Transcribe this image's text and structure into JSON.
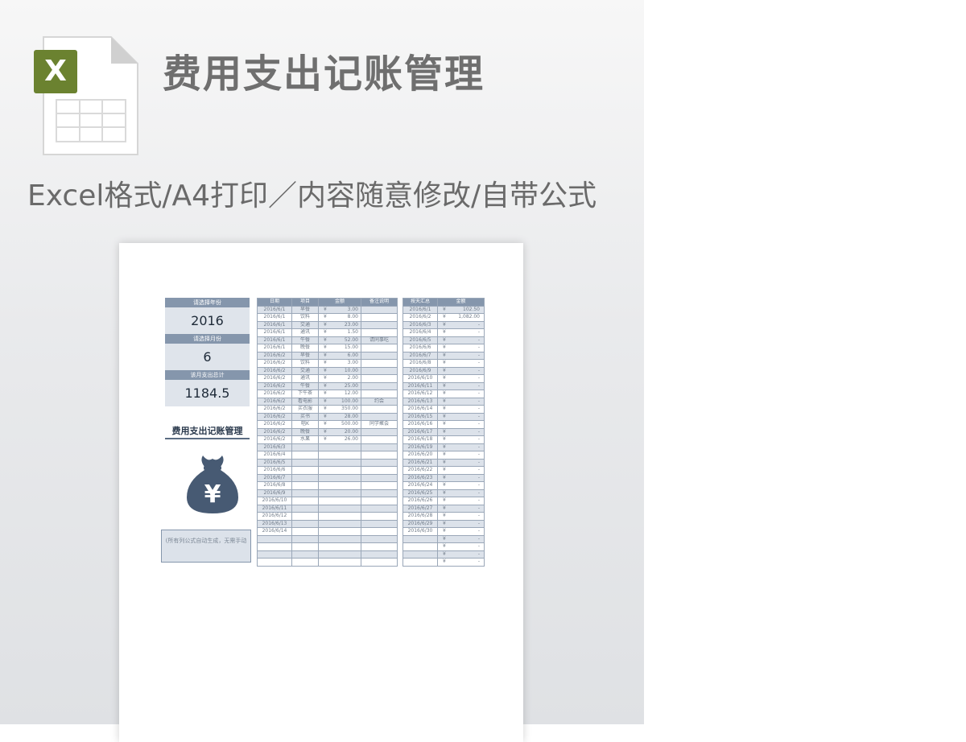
{
  "header": {
    "title": "费用支出记账管理",
    "subtitle": "Excel格式/A4打印／内容随意修改/自带公式",
    "icon": "excel-file-icon",
    "icon_letter": "X",
    "accent": "#6b8230"
  },
  "sheet": {
    "left_panel": {
      "year_label": "请选择年份",
      "year_value": "2016",
      "month_label": "请选择月份",
      "month_value": "6",
      "total_label": "该月支出总计",
      "total_value": "1184.5",
      "title": "费用支出记账管理",
      "bag_icon": "money-bag-icon",
      "bag_symbol": "¥",
      "note": "(所有列公式自动生成，无需手动"
    },
    "main_table": {
      "headers": [
        "日期",
        "项目",
        "金额",
        "备注说明"
      ],
      "rows": [
        {
          "date": "2016/6/1",
          "item": "早餐",
          "amount": "3.00",
          "note": ""
        },
        {
          "date": "2016/6/1",
          "item": "饮料",
          "amount": "8.00",
          "note": ""
        },
        {
          "date": "2016/6/1",
          "item": "交通",
          "amount": "23.00",
          "note": ""
        },
        {
          "date": "2016/6/1",
          "item": "通讯",
          "amount": "1.50",
          "note": ""
        },
        {
          "date": "2016/6/1",
          "item": "午餐",
          "amount": "52.00",
          "note": "请同事吃"
        },
        {
          "date": "2016/6/1",
          "item": "晚餐",
          "amount": "15.00",
          "note": ""
        },
        {
          "date": "2016/6/2",
          "item": "早餐",
          "amount": "6.00",
          "note": ""
        },
        {
          "date": "2016/6/2",
          "item": "饮料",
          "amount": "3.00",
          "note": ""
        },
        {
          "date": "2016/6/2",
          "item": "交通",
          "amount": "10.00",
          "note": ""
        },
        {
          "date": "2016/6/2",
          "item": "通讯",
          "amount": "2.00",
          "note": ""
        },
        {
          "date": "2016/6/2",
          "item": "午餐",
          "amount": "25.00",
          "note": ""
        },
        {
          "date": "2016/6/2",
          "item": "下午茶",
          "amount": "12.00",
          "note": ""
        },
        {
          "date": "2016/6/2",
          "item": "看电影",
          "amount": "100.00",
          "note": "约会"
        },
        {
          "date": "2016/6/2",
          "item": "买衣服",
          "amount": "350.00",
          "note": ""
        },
        {
          "date": "2016/6/2",
          "item": "买书",
          "amount": "28.00",
          "note": ""
        },
        {
          "date": "2016/6/2",
          "item": "唱K",
          "amount": "500.00",
          "note": "同学聚会"
        },
        {
          "date": "2016/6/2",
          "item": "晚餐",
          "amount": "20.00",
          "note": ""
        },
        {
          "date": "2016/6/2",
          "item": "水果",
          "amount": "26.00",
          "note": ""
        },
        {
          "date": "2016/6/3",
          "item": "",
          "amount": "",
          "note": ""
        },
        {
          "date": "2016/6/4",
          "item": "",
          "amount": "",
          "note": ""
        },
        {
          "date": "2016/6/5",
          "item": "",
          "amount": "",
          "note": ""
        },
        {
          "date": "2016/6/6",
          "item": "",
          "amount": "",
          "note": ""
        },
        {
          "date": "2016/6/7",
          "item": "",
          "amount": "",
          "note": ""
        },
        {
          "date": "2016/6/8",
          "item": "",
          "amount": "",
          "note": ""
        },
        {
          "date": "2016/6/9",
          "item": "",
          "amount": "",
          "note": ""
        },
        {
          "date": "2016/6/10",
          "item": "",
          "amount": "",
          "note": ""
        },
        {
          "date": "2016/6/11",
          "item": "",
          "amount": "",
          "note": ""
        },
        {
          "date": "2016/6/12",
          "item": "",
          "amount": "",
          "note": ""
        },
        {
          "date": "2016/6/13",
          "item": "",
          "amount": "",
          "note": ""
        },
        {
          "date": "2016/6/14",
          "item": "",
          "amount": "",
          "note": ""
        },
        {
          "date": "",
          "item": "",
          "amount": "",
          "note": ""
        },
        {
          "date": "",
          "item": "",
          "amount": "",
          "note": ""
        },
        {
          "date": "",
          "item": "",
          "amount": "",
          "note": ""
        },
        {
          "date": "",
          "item": "",
          "amount": "",
          "note": ""
        }
      ]
    },
    "summary_table": {
      "headers": [
        "按天汇总",
        "金额"
      ],
      "currency": "¥",
      "rows": [
        {
          "date": "2016/6/1",
          "amount": "102.50"
        },
        {
          "date": "2016/6/2",
          "amount": "1,082.00"
        },
        {
          "date": "2016/6/3",
          "amount": "-"
        },
        {
          "date": "2016/6/4",
          "amount": "-"
        },
        {
          "date": "2016/6/5",
          "amount": "-"
        },
        {
          "date": "2016/6/6",
          "amount": "-"
        },
        {
          "date": "2016/6/7",
          "amount": "-"
        },
        {
          "date": "2016/6/8",
          "amount": "-"
        },
        {
          "date": "2016/6/9",
          "amount": "-"
        },
        {
          "date": "2016/6/10",
          "amount": "-"
        },
        {
          "date": "2016/6/11",
          "amount": "-"
        },
        {
          "date": "2016/6/12",
          "amount": "-"
        },
        {
          "date": "2016/6/13",
          "amount": "-"
        },
        {
          "date": "2016/6/14",
          "amount": "-"
        },
        {
          "date": "2016/6/15",
          "amount": "-"
        },
        {
          "date": "2016/6/16",
          "amount": "-"
        },
        {
          "date": "2016/6/17",
          "amount": "-"
        },
        {
          "date": "2016/6/18",
          "amount": "-"
        },
        {
          "date": "2016/6/19",
          "amount": "-"
        },
        {
          "date": "2016/6/20",
          "amount": "-"
        },
        {
          "date": "2016/6/21",
          "amount": "-"
        },
        {
          "date": "2016/6/22",
          "amount": "-"
        },
        {
          "date": "2016/6/23",
          "amount": "-"
        },
        {
          "date": "2016/6/24",
          "amount": "-"
        },
        {
          "date": "2016/6/25",
          "amount": "-"
        },
        {
          "date": "2016/6/26",
          "amount": "-"
        },
        {
          "date": "2016/6/27",
          "amount": "-"
        },
        {
          "date": "2016/6/28",
          "amount": "-"
        },
        {
          "date": "2016/6/29",
          "amount": "-"
        },
        {
          "date": "2016/6/30",
          "amount": "-"
        },
        {
          "date": "",
          "amount": "-"
        },
        {
          "date": "",
          "amount": "-"
        },
        {
          "date": "",
          "amount": "-"
        },
        {
          "date": "",
          "amount": "-"
        }
      ]
    }
  }
}
